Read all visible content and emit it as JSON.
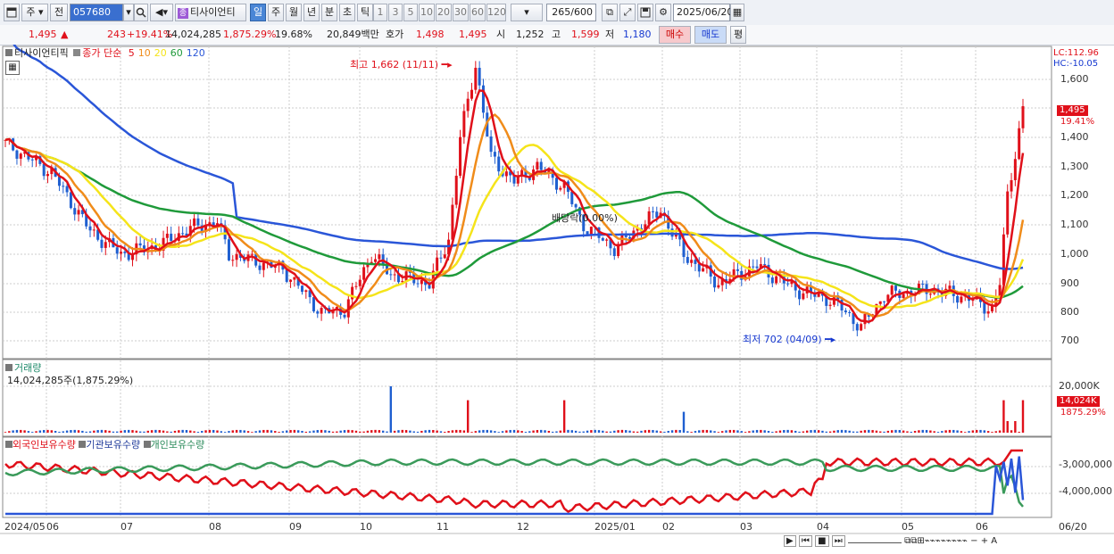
{
  "toolbar": {
    "market": "주",
    "prev_label": "전",
    "code": "057680",
    "stock_name": "티사이언티",
    "periods": [
      "일",
      "주",
      "월",
      "년",
      "분",
      "초",
      "틱"
    ],
    "active_period": "일",
    "intervals": [
      "1",
      "3",
      "5",
      "10",
      "20",
      "30",
      "60",
      "120"
    ],
    "count": "265",
    "count_total": "/600",
    "date": "2025/06/20"
  },
  "quote": {
    "price": "1,495",
    "change": "243",
    "change_rate": "+19.41%",
    "volume": "14,024,285",
    "volume_rate": "1,875.29%",
    "turnover": "19.68%",
    "amount": "20,849백만",
    "ask_label": "호가",
    "ask": "1,498",
    "bid": "1,495",
    "open_label": "시",
    "open": "1,252",
    "high_label": "고",
    "high": "1,599",
    "low_label": "저",
    "low": "1,180",
    "buy_label": "매수",
    "sell_label": "매도",
    "eval_label": "평"
  },
  "price_panel": {
    "name": "티사이언티픽",
    "ma_prefix": "종가 단순",
    "ma_periods": [
      "5",
      "10",
      "20",
      "60",
      "120"
    ],
    "lc": "LC:112.96",
    "hc": "HC:-10.05",
    "high_note": "최고 1,662 (11/11)",
    "low_note": "최저 702 (04/09)",
    "dividend_note": "배당락(0.00%)",
    "y_ticks": [
      "1,600",
      "1,400",
      "1,300",
      "1,200",
      "1,100",
      "1,000",
      "900",
      "800",
      "700"
    ],
    "current_badge": "1,495",
    "current_rate": "19.41%"
  },
  "volume_panel": {
    "title": "거래량",
    "info": "14,024,285주(1,875.29%)",
    "y_tick": "20,000K",
    "current_badge": "14,024K",
    "current_rate": "1875.29%"
  },
  "holding_panel": {
    "series": [
      "외국인보유수량",
      "기관보유수량",
      "개인보유수량"
    ],
    "y_ticks": [
      "-3,000,000",
      "-4,000,000"
    ]
  },
  "x_axis": {
    "labels": [
      "2024/05",
      "06",
      "07",
      "08",
      "09",
      "10",
      "11",
      "12",
      "2025/01",
      "02",
      "03",
      "04",
      "05",
      "06"
    ],
    "last_date": "06/20"
  },
  "colors": {
    "up": "#e0101a",
    "down": "#1f5fd0",
    "ma5": "#e0101a",
    "ma10": "#f08c1a",
    "ma20": "#f5e41a",
    "ma60": "#1f9a3a",
    "ma120": "#2a56d8",
    "foreign": "#e0101a",
    "institution": "#3a9a5a",
    "individual": "#2a56d8"
  },
  "icons": [
    "window-icon",
    "search-icon",
    "speaker-icon",
    "link-icon",
    "save-icon",
    "settings-icon",
    "calendar-icon"
  ]
}
